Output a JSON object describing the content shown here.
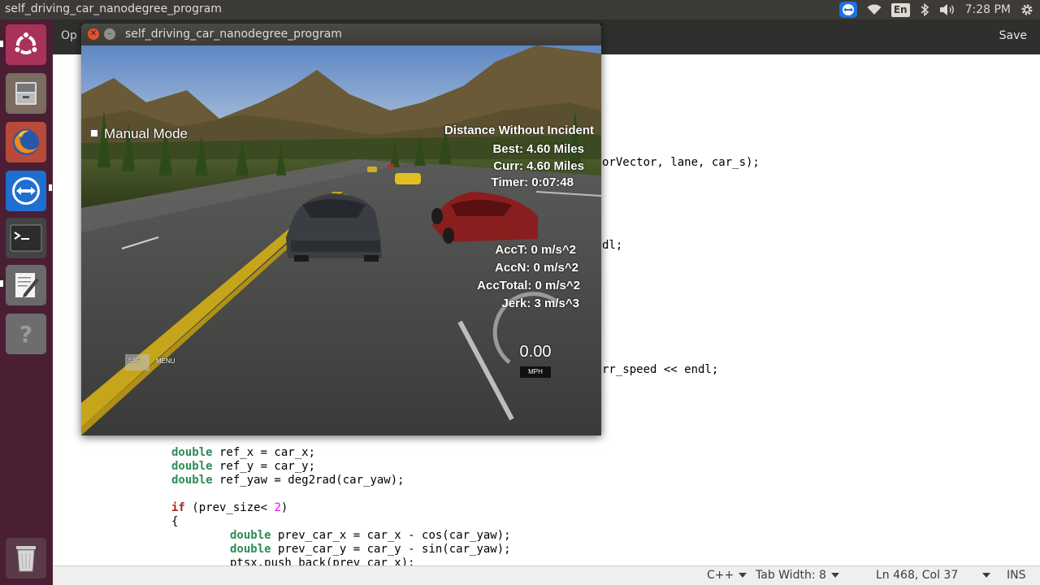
{
  "top_panel": {
    "app_title": "self_driving_car_nanodegree_program",
    "language": "En",
    "clock": "7:28 PM",
    "icons": [
      "teamviewer-icon",
      "wifi-icon",
      "keyboard-language-icon",
      "bluetooth-icon",
      "volume-icon",
      "settings-gear-icon"
    ]
  },
  "launcher": {
    "items": [
      {
        "name": "ubuntu-dash",
        "icon": "ubuntu-logo-icon"
      },
      {
        "name": "files",
        "icon": "file-cabinet-icon"
      },
      {
        "name": "firefox",
        "icon": "firefox-icon"
      },
      {
        "name": "teamviewer",
        "icon": "teamviewer-icon"
      },
      {
        "name": "terminal",
        "icon": "terminal-icon"
      },
      {
        "name": "text-editor",
        "icon": "text-editor-icon"
      },
      {
        "name": "help",
        "icon": "help-icon"
      },
      {
        "name": "trash",
        "icon": "trash-icon"
      }
    ]
  },
  "editor": {
    "open_label": "Op",
    "save_label": "Save",
    "code_fragments": {
      "frag1": "orVector, lane, car_s);",
      "frag2": "dl;",
      "frag3": "rr_speed << endl;"
    },
    "code_lines": [
      {
        "type": "double",
        "rest": " ref_x = car_x;"
      },
      {
        "type": "double",
        "rest": " ref_y = car_y;"
      },
      {
        "type": "double",
        "rest": " ref_yaw = deg2rad(car_yaw);"
      },
      {
        "kw": "if",
        "pre": " (prev_size< ",
        "num": "2",
        "post": ")"
      },
      {
        "text": "{"
      },
      {
        "type": "double",
        "rest": " prev_car_x = car_x - cos(car_yaw);"
      },
      {
        "type": "double",
        "rest": " prev_car_y = car_y - sin(car_yaw);"
      },
      {
        "text": "ptsx.push_back(prev_car_x);"
      }
    ],
    "status": {
      "language": "C++",
      "tab_width": "Tab Width: 8",
      "position": "Ln 468, Col 37",
      "mode": "INS"
    }
  },
  "simulator": {
    "window_title": "self_driving_car_nanodegree_program",
    "mode_label": "Manual Mode",
    "distance_title": "Distance Without Incident",
    "best": "Best: 4.60 Miles",
    "curr": "Curr: 4.60 Miles",
    "timer": "Timer: 0:07:48",
    "acc_t": "AccT: 0 m/s^2",
    "acc_n": "AccN: 0 m/s^2",
    "acc_total": "AccTotal: 0 m/s^2",
    "jerk": "Jerk: 3 m/s^3",
    "speed": "0.00",
    "speed_unit": "MPH",
    "esc_label": "ESC",
    "menu_label": "MENU"
  },
  "colors": {
    "launcher_bg": "#4a1f34",
    "panel_bg": "#3c3b37",
    "close_button": "#e2522b",
    "code_type_keyword": "#2e8b57",
    "code_control_keyword": "#a52a2a",
    "code_number": "#ff00ff"
  }
}
